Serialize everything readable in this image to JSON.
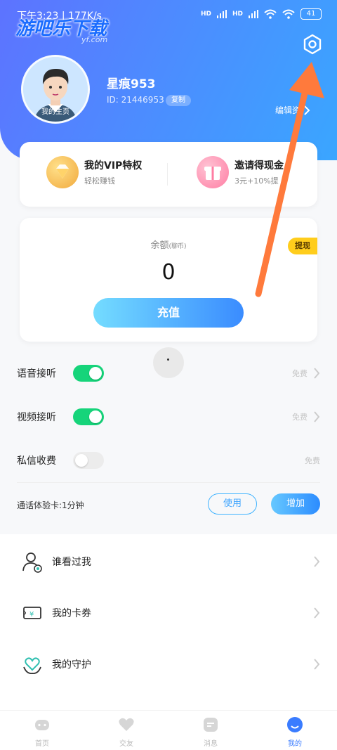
{
  "status_bar": {
    "time": "下午3:23 | 177K/s",
    "hd1": "HD",
    "hd2": "HD",
    "battery": "41"
  },
  "watermark": {
    "text": "游吧乐下载",
    "url": "yf.com"
  },
  "profile": {
    "avatar_label": "我的主页",
    "username": "星痕953",
    "id_text": "ID: 21446953",
    "copy_label": "复制",
    "edit_label": "编辑资"
  },
  "vip": {
    "title": "我的VIP特权",
    "subtitle": "轻松赚钱",
    "invite_title": "邀请得现金",
    "invite_subtitle": "3元+10%提"
  },
  "balance": {
    "label": "余额",
    "unit": "(聊币)",
    "value": "0",
    "withdraw_label": "提现",
    "recharge_label": "充值"
  },
  "settings": [
    {
      "label": "语音接听",
      "on": true,
      "value": "免费"
    },
    {
      "label": "视频接听",
      "on": true,
      "value": "免费"
    },
    {
      "label": "私信收费",
      "on": false,
      "value": "免费"
    }
  ],
  "trial": {
    "prefix": "通话体验卡:",
    "value": "1分钟",
    "use_label": "使用",
    "add_label": "增加"
  },
  "menu": [
    {
      "label": "谁看过我",
      "icon": "visitor-icon"
    },
    {
      "label": "我的卡券",
      "icon": "coupon-icon"
    },
    {
      "label": "我的守护",
      "icon": "guard-heart-icon"
    }
  ],
  "nav": [
    {
      "label": "首页",
      "icon": "home-icon"
    },
    {
      "label": "交友",
      "icon": "heart-icon"
    },
    {
      "label": "消息",
      "icon": "message-icon"
    },
    {
      "label": "我的",
      "icon": "profile-icon",
      "active": true
    }
  ],
  "colors": {
    "header_start": "#5d73ff",
    "header_end": "#3aa6ff",
    "toggle_on": "#16d47a",
    "accent": "#3a7cff",
    "withdraw": "#ffcd1c",
    "arrow": "#ff7a3c"
  }
}
